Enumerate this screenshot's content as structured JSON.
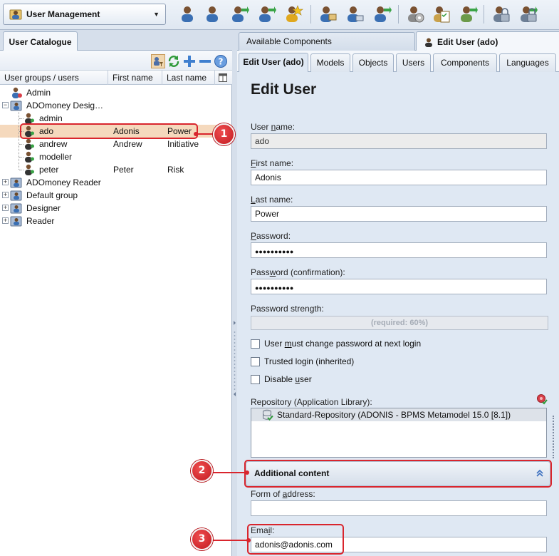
{
  "toolbar": {
    "module_label": "User Management",
    "buttons": [
      "user-icon",
      "user-edit-icon",
      "user-import-icon",
      "user-export-icon",
      "user-star-icon",
      "user-key-icon",
      "user-transfer-icon",
      "user-undo-icon",
      "settings-gear-icon",
      "checklist-icon",
      "document-export-icon",
      "lock-icon",
      "lock-export-icon"
    ]
  },
  "left": {
    "tab_label": "User Catalogue",
    "columns": {
      "groups": "User groups / users",
      "first_name": "First name",
      "last_name": "Last name"
    },
    "tree": [
      {
        "label": "Admin",
        "first": "",
        "last": "",
        "level": 0,
        "type": "user-admin",
        "expand": ""
      },
      {
        "label": "ADOmoney Desig…",
        "first": "",
        "last": "",
        "level": 0,
        "type": "group",
        "expand": "−"
      },
      {
        "label": "admin",
        "first": "",
        "last": "",
        "level": 1,
        "type": "user",
        "expand": ""
      },
      {
        "label": "ado",
        "first": "Adonis",
        "last": "Power",
        "level": 1,
        "type": "user",
        "expand": "",
        "selected": true
      },
      {
        "label": "andrew",
        "first": "Andrew",
        "last": "Initiative",
        "level": 1,
        "type": "user",
        "expand": ""
      },
      {
        "label": "modeller",
        "first": "",
        "last": "",
        "level": 1,
        "type": "user",
        "expand": ""
      },
      {
        "label": "peter",
        "first": "Peter",
        "last": "Risk",
        "level": 1,
        "type": "user",
        "expand": ""
      },
      {
        "label": "ADOmoney Reader",
        "first": "",
        "last": "",
        "level": 0,
        "type": "group",
        "expand": "+"
      },
      {
        "label": "Default group",
        "first": "",
        "last": "",
        "level": 0,
        "type": "group",
        "expand": "+"
      },
      {
        "label": "Designer",
        "first": "",
        "last": "",
        "level": 0,
        "type": "group",
        "expand": "+"
      },
      {
        "label": "Reader",
        "first": "",
        "last": "",
        "level": 0,
        "type": "group",
        "expand": "+"
      }
    ]
  },
  "right": {
    "tabs": {
      "available": "Available Components",
      "edit_user": "Edit User (ado)"
    },
    "subtabs": [
      "Edit User (ado)",
      "Models",
      "Objects",
      "Users",
      "Components",
      "Languages"
    ],
    "form": {
      "title": "Edit User",
      "username": {
        "label_pre": "User ",
        "label_u": "n",
        "label_post": "ame:",
        "value": "ado"
      },
      "first_name": {
        "label_pre": "",
        "label_u": "F",
        "label_post": "irst name:",
        "value": "Adonis"
      },
      "last_name": {
        "label_pre": "",
        "label_u": "L",
        "label_post": "ast name:",
        "value": "Power"
      },
      "password": {
        "label_pre": "",
        "label_u": "P",
        "label_post": "assword:",
        "value": "●●●●●●●●●●"
      },
      "password_confirm": {
        "label_pre": "Pass",
        "label_u": "w",
        "label_post": "ord (confirmation):",
        "value": "●●●●●●●●●●"
      },
      "strength_label": "Password strength:",
      "strength_text": "(required: 60%)",
      "check_change": {
        "pre": "User ",
        "u": "m",
        "post": "ust change password at next login"
      },
      "check_trusted": {
        "pre": "Trusted login (inherited)",
        "u": "",
        "post": ""
      },
      "check_disable": {
        "pre": "Disable ",
        "u": "u",
        "post": "ser"
      },
      "repository_label": "Repository (Application Library):",
      "repository_item": "Standard-Repository (ADONIS - BPMS Metamodel 15.0 [8.1])",
      "additional_content": "Additional content",
      "form_of_address": {
        "label_pre": "Form of ",
        "label_u": "a",
        "label_post": "ddress:",
        "value": ""
      },
      "email": {
        "label_pre": "Ema",
        "label_u": "i",
        "label_post": "l:",
        "value": "adonis@adonis.com"
      }
    }
  },
  "annotations": [
    "1",
    "2",
    "3"
  ],
  "colors": {
    "accent_red": "#d9252d",
    "selection": "#f5d9bd",
    "panel": "#dfe8f3"
  }
}
